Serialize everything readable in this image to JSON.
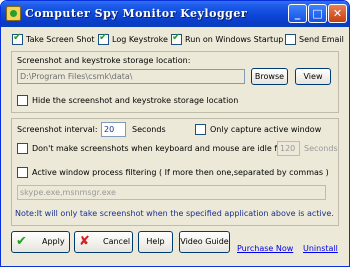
{
  "window": {
    "title": "Computer Spy Monitor Keylogger",
    "buttons": {
      "minimize": "_",
      "maximize": "□",
      "close": "✕"
    }
  },
  "options": {
    "take_screenshot": {
      "label": "Take Screen Shot",
      "checked": true
    },
    "log_keystroke": {
      "label": "Log Keystroke",
      "checked": true
    },
    "run_on_startup": {
      "label": "Run on Windows Startup",
      "checked": true
    },
    "send_email": {
      "label": "Send Email",
      "checked": false
    }
  },
  "storage": {
    "heading": "Screenshot and keystroke storage location:",
    "path": "D:\\Program Files\\csmk\\data\\",
    "browse_label": "Browse",
    "view_label": "View",
    "hide_label": "Hide the screenshot and keystroke storage location",
    "hide_checked": false
  },
  "screenshot": {
    "interval_label": "Screenshot interval:",
    "interval_value": "20",
    "seconds_label": "Seconds",
    "only_active_label": "Only capture active window",
    "only_active_checked": false,
    "idle_label": "Don't make screenshots when keyboard and mouse are idle for",
    "idle_checked": false,
    "idle_value": "120",
    "idle_seconds_label": "Seconds",
    "filter_label": "Active window process filtering ( If  more then one,separated by commas )",
    "filter_checked": false,
    "filter_value": "skype.exe,msnmsgr.exe",
    "note": "Note:It will only take screenshot when the specified application above is active."
  },
  "footer": {
    "apply_label": "Apply",
    "cancel_label": "Cancel",
    "help_label": "Help",
    "video_label": "Video Guide",
    "purchase_label": "Purchase Now",
    "uninstall_label": "Uninstall"
  },
  "colors": {
    "accent": "#0a3cc6",
    "check": "#21a121",
    "link": "#0000ee",
    "cancel_icon": "#d81e1e"
  }
}
